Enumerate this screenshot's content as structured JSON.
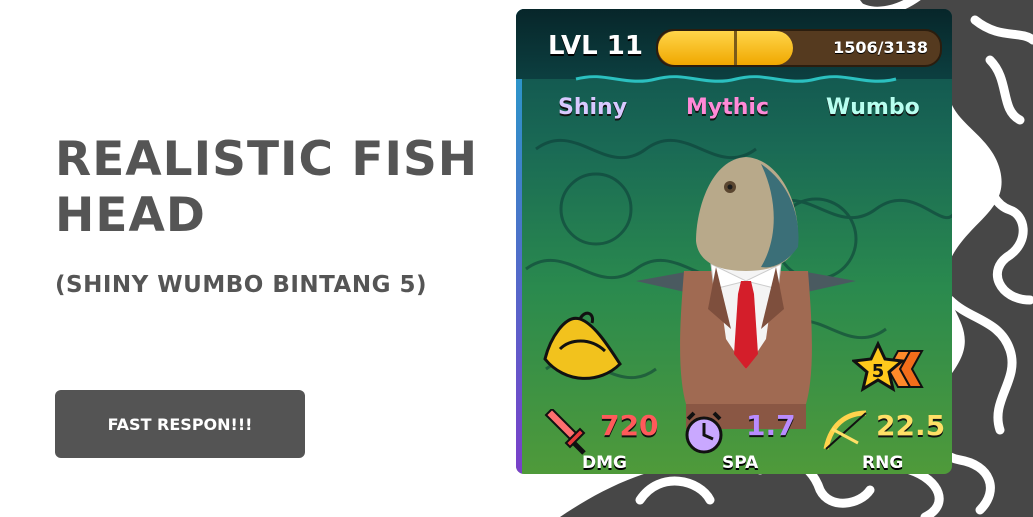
{
  "banner": {
    "title_line1": "REALISTIC FISH",
    "title_line2": "HEAD",
    "subtitle": "(SHINY WUMBO BINTANG 5)",
    "cta_label": "FAST RESPON!!!"
  },
  "card": {
    "level_label": "LVL 11",
    "xp_text": "1506/3138",
    "xp_progress": 0.48,
    "tags": [
      {
        "label": "Shiny",
        "color": "#d9c9ff"
      },
      {
        "label": "Mythic",
        "color": "#ff8ad8"
      },
      {
        "label": "Wumbo",
        "color": "#b8fff0"
      }
    ],
    "star_count": "5",
    "stats": [
      {
        "value": "720",
        "label": "DMG",
        "color": "#ff5a5a",
        "icon": "sword-icon"
      },
      {
        "value": "1.7",
        "label": "SPA",
        "color": "#b98cff",
        "icon": "clock-icon"
      },
      {
        "value": "22.5",
        "label": "RNG",
        "color": "#ffe066",
        "icon": "bow-icon"
      }
    ]
  },
  "colors": {
    "text_dark": "#555555",
    "button_bg": "#545454",
    "blob": "#474747"
  }
}
